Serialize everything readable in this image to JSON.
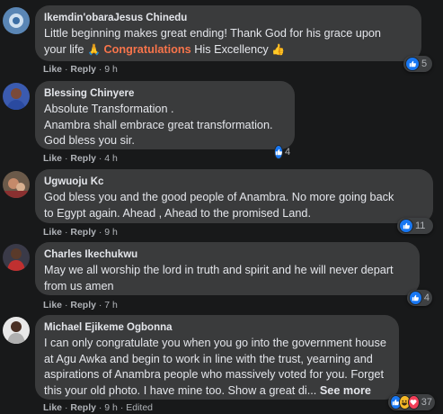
{
  "actions": {
    "like": "Like",
    "reply": "Reply",
    "dot": "·"
  },
  "comments": [
    {
      "author": "Ikemdin'obaraJesus Chinedu",
      "line1": "Little beginning makes great ending! Thank God for his grace upon",
      "line2_pre": "your life",
      "line2_emoji1": "🙏",
      "line2_highlight": "Congratulations",
      "line2_post": "His Excellency",
      "line2_emoji2": "👍",
      "time": "9 h",
      "reaction_count": "5",
      "reaction_icons": [
        "like-icon"
      ]
    },
    {
      "author": "Blessing Chinyere",
      "lines": [
        "Absolute Transformation .",
        "Anambra shall embrace great transformation.",
        "God bless you sir."
      ],
      "time": "4 h",
      "reaction_count": "4",
      "reaction_icons": [
        "like-icon"
      ]
    },
    {
      "author": "Ugwuoju Kc",
      "lines": [
        "God bless you and the good people of Anambra. No more going back",
        "to Egypt again. Ahead , Ahead to the promised Land."
      ],
      "time": "9 h",
      "reaction_count": "11",
      "reaction_icons": [
        "like-icon"
      ]
    },
    {
      "author": "Charles Ikechukwu",
      "lines": [
        "May we all worship the lord in truth and spirit and he will never depart",
        "from us amen"
      ],
      "time": "7 h",
      "reaction_count": "4",
      "reaction_icons": [
        "like-icon"
      ]
    },
    {
      "author": "Michael Ejikeme Ogbonna",
      "lines": [
        "I can only congratulate you when you go into the government house",
        "at Agu Awka and begin to work in line with the trust, yearning and",
        "aspirations of Anambra people who massively voted for you. Forget"
      ],
      "last_line": "this your old photo. I have mine too. Show a great di...",
      "see_more": "See more",
      "time": "9 h",
      "edited": "Edited",
      "reaction_count": "37",
      "reaction_icons": [
        "like-icon",
        "haha-icon",
        "love-icon"
      ]
    }
  ],
  "colors": {
    "background": "#18191a",
    "bubble": "#3a3b3c",
    "like_blue": "#1877f2",
    "highlight": "#f7744b"
  }
}
